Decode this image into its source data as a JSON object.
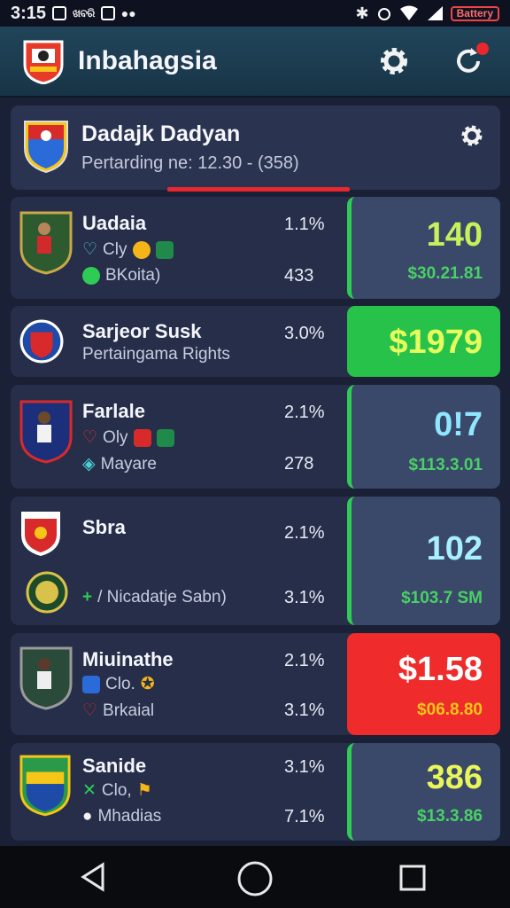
{
  "status": {
    "time": "3:15",
    "notif_text": "ଖବରି",
    "battery": "Battery"
  },
  "app": {
    "title": "Inbahagsia"
  },
  "header": {
    "title": "Dadajk Dadyan",
    "subtitle": "Pertarding ne: 12.30 - (358)"
  },
  "rows": [
    {
      "name": "Uadaia",
      "line1": "Cly",
      "line2": "BKoita)",
      "pct1": "1.1%",
      "pct2": "433",
      "value": "140",
      "sub": "$30.21.81",
      "value_color": "#c8f05a",
      "box_color": "#3a4869"
    },
    {
      "name": "Sarjeor Susk",
      "line1": "Pertaingama Rights",
      "pct1": "3.0%",
      "value": "$1979",
      "value_color": "#e6ff5c",
      "box_color": "#26c24a"
    },
    {
      "name": "Farlale",
      "line1": "Oly",
      "line2": "Mayare",
      "pct1": "2.1%",
      "pct2": "278",
      "value": "0!7",
      "sub": "$113.3.01",
      "value_color": "#8ee6ff",
      "box_color": "#3a4869"
    },
    {
      "name": "Sbra",
      "line2": "/ Nicadatje Sabn)",
      "pct1": "2.1%",
      "pct2": "3.1%",
      "value": "102",
      "sub": "$103.7 SM",
      "value_color": "#a8f0ff",
      "box_color": "#3a4869"
    },
    {
      "name": "Miuinathe",
      "line1": "Clo.",
      "line2": "Brkaial",
      "pct1": "2.1%",
      "pct2": "3.1%",
      "value": "$1.58",
      "sub": "$06.8.80",
      "value_color": "#ffffff",
      "box_color": "#ef2b2b"
    },
    {
      "name": "Sanide",
      "line1": "Clo,",
      "line2": "Mhadias",
      "pct1": "3.1%",
      "pct2": "7.1%",
      "value": "386",
      "sub": "$13.3.86",
      "value_color": "#e8f55a",
      "box_color": "#3a4869"
    }
  ],
  "colors": {
    "accent_red": "#e8282c",
    "accent_green": "#2ecc55",
    "bg": "#1a2035",
    "card": "#262e49"
  },
  "icons": [
    "back-icon",
    "home-icon",
    "recents-icon",
    "gear-icon",
    "refresh-icon",
    "bluetooth-icon",
    "wifi-icon",
    "signal-icon"
  ]
}
